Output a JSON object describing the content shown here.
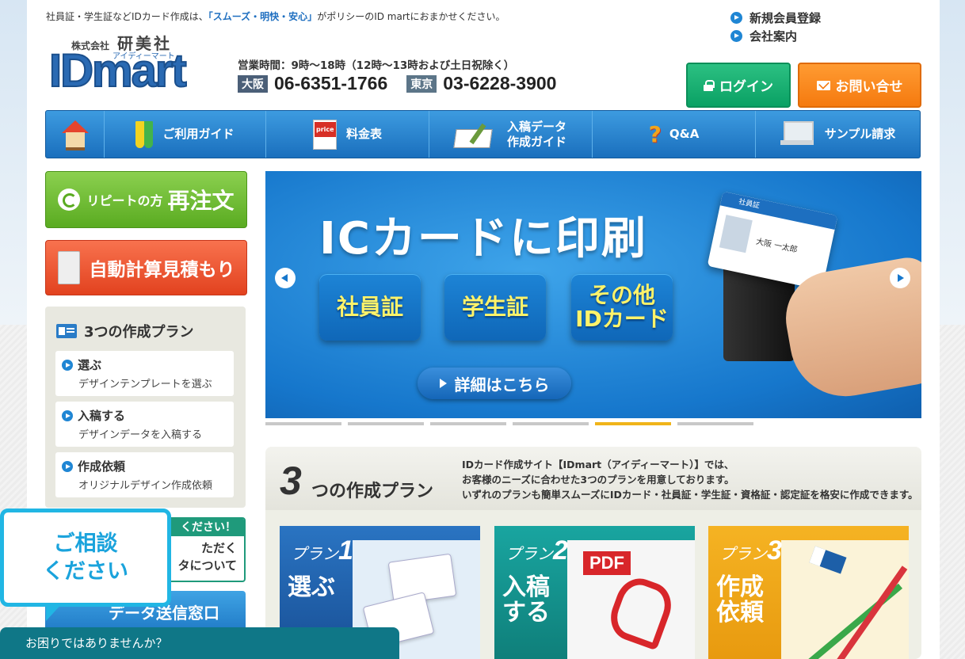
{
  "header": {
    "notice_before": "社員証・学生証などIDカード作成は、",
    "notice_highlight": "「スムーズ・明快・安心」",
    "notice_after": "がポリシーのID martにおまかせください。",
    "company_prefix": "株式会社",
    "company_name": "研美社",
    "logo_text": "IDmart",
    "logo_kana": "アイディーマート",
    "hours": "営業時間：9時〜18時（12時〜13時および土日祝除く）",
    "osaka_label": "大阪",
    "osaka_phone": "06-6351-1766",
    "tokyo_label": "東京",
    "tokyo_phone": "03-6228-3900",
    "links": [
      "新規会員登録",
      "会社案内"
    ],
    "login_label": "ログイン",
    "contact_label": "お問い合せ"
  },
  "nav": {
    "items": [
      "ご利用ガイド",
      "料金表",
      "入稿データ",
      "作成ガイド",
      "Q&A",
      "サンプル請求"
    ],
    "price_icon_text": "price"
  },
  "sidebar": {
    "reorder_small": "リピートの方",
    "reorder_big": "再注文",
    "estimate": "自動計算見積もり",
    "plans_title": "3つの作成プラン",
    "plans": [
      {
        "title": "選ぶ",
        "desc": "デザインテンプレートを選ぶ"
      },
      {
        "title": "入稿する",
        "desc": "デザインデータを入稿する"
      },
      {
        "title": "作成依頼",
        "desc": "オリジナルデザイン作成依頼"
      }
    ],
    "green_top": "ください！",
    "green_line1": "ただく",
    "green_line2": "タについて",
    "send": "データ送信窓口"
  },
  "banner": {
    "title": "ICカードに印刷",
    "boxes": [
      "社員証",
      "学生証",
      "その他",
      "IDカード"
    ],
    "more": "詳細はこちら",
    "card_header": "社員証",
    "card_name": "大阪 一太郎",
    "active_slide": 5,
    "slide_count": 6
  },
  "plans_section": {
    "big_number": "3",
    "title": "つの作成プラン",
    "desc": [
      "IDカード作成サイト【IDmart（アイディーマート）】では、",
      "お客様のニーズに合わせた3つのプランを用意しております。",
      "いずれのプランも簡単スムーズにIDカード・社員証・学生証・資格証・認定証を格安に作成できます。"
    ],
    "cards": [
      {
        "label": "プラン",
        "num": "1",
        "action": "選ぶ"
      },
      {
        "label": "プラン",
        "num": "2",
        "action1": "入稿",
        "action2": "する"
      },
      {
        "label": "プラン",
        "num": "3",
        "action1": "作成",
        "action2": "依頼"
      }
    ],
    "pdf_text": "PDF"
  },
  "chat": {
    "bubble_line1": "ご相談",
    "bubble_line2": "ください",
    "bar": "お困りではありませんか？"
  },
  "colors": {
    "accent": "#1f6fc0",
    "login": "#0aa164",
    "contact": "#f57a0f",
    "chat": "#21b6e4"
  }
}
